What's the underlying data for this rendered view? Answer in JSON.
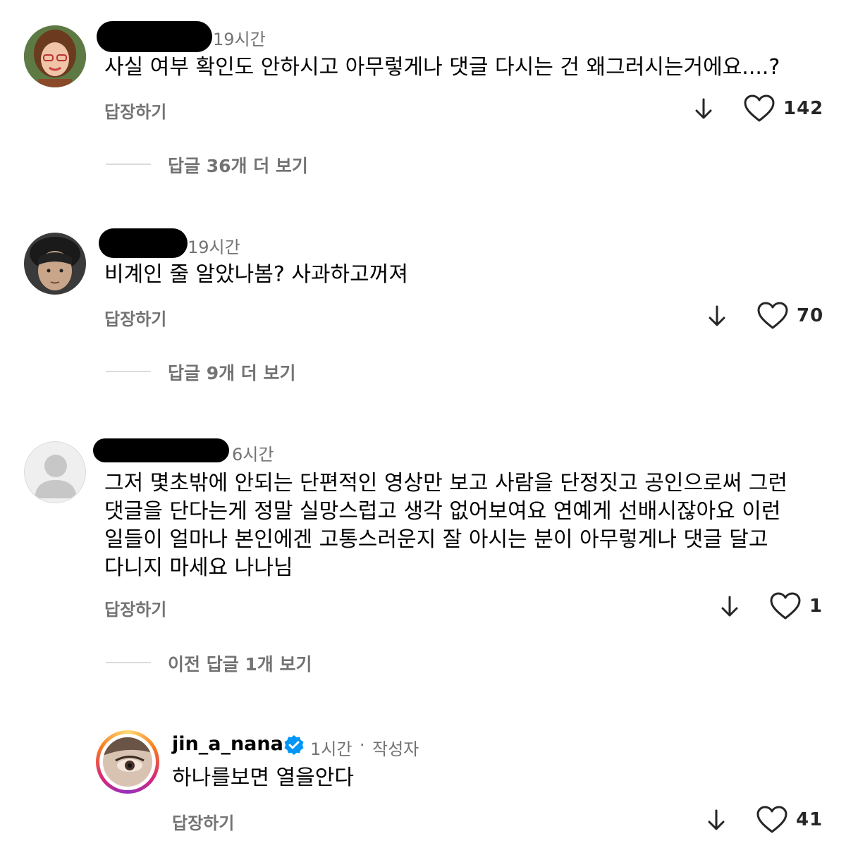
{
  "comments": [
    {
      "time": "19시간",
      "text": "사실 여부 확인도 안하시고 아무렇게나 댓글 다시는 건 왜그러시는거에요....?",
      "reply_label": "답장하기",
      "likes": "142",
      "more_replies": "답글 36개 더 보기",
      "icons": [
        "arrow-down-icon",
        "heart-icon"
      ]
    },
    {
      "time": "19시간",
      "text": "비계인 줄 알았나봄? 사과하고꺼져",
      "reply_label": "답장하기",
      "likes": "70",
      "more_replies": "답글 9개 더 보기",
      "icons": [
        "arrow-down-icon",
        "heart-icon"
      ]
    },
    {
      "time": "6시간",
      "text": "그저 몇초밖에 안되는 단편적인 영상만 보고 사람을 단정짓고 공인으로써 그런\n댓글을 단다는게 정말 실망스럽고 생각 없어보여요 연예게 선배시잖아요 이런\n일들이 얼마나 본인에겐 고통스러운지 잘 아시는 분이 아무렇게나 댓글 달고\n다니지 마세요 나나님",
      "reply_label": "답장하기",
      "likes": "1",
      "more_replies": "이전 답글 1개 보기",
      "icons": [
        "arrow-down-icon",
        "heart-icon"
      ]
    }
  ],
  "author_reply": {
    "username": "jin_a_nana",
    "verified_icon": "verified-badge-icon",
    "time": "1시간",
    "separator": "·",
    "author_label": "작성자",
    "text": "하나를보면 열을안다",
    "reply_label": "답장하기",
    "likes": "41"
  },
  "colors": {
    "secondary_text": "#737373",
    "verified_blue": "#0095f6",
    "story_ring": [
      "#feda75",
      "#fa7e1e",
      "#d62976",
      "#962fbf"
    ]
  }
}
